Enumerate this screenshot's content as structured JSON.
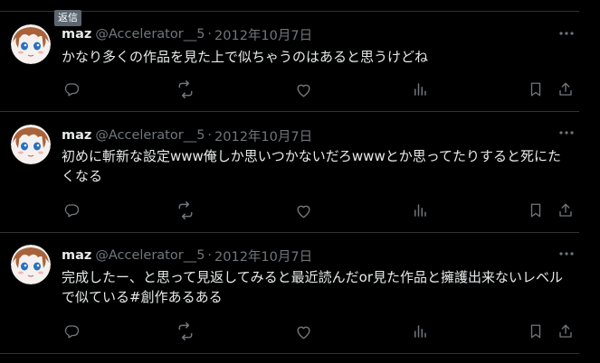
{
  "tooltip": {
    "reply": "返信"
  },
  "tweets": [
    {
      "name": "maz",
      "handle": "@Accelerator__5",
      "separator": "·",
      "date": "2012年10月7日",
      "text": "かなり多くの作品を見た上で似ちゃうのはあると思うけどね"
    },
    {
      "name": "maz",
      "handle": "@Accelerator__5",
      "separator": "·",
      "date": "2012年10月7日",
      "text": "初めに斬新な設定www俺しか思いつかないだろwwwとか思ってたりすると死にたくなる"
    },
    {
      "name": "maz",
      "handle": "@Accelerator__5",
      "separator": "·",
      "date": "2012年10月7日",
      "text": "完成したー、と思って見返してみると最近読んだor見た作品と擁護出来ないレベルで似ている#創作あるある"
    }
  ],
  "icons": {
    "reply": "reply-icon",
    "retweet": "retweet-icon",
    "like": "like-icon",
    "views": "views-icon",
    "bookmark": "bookmark-icon",
    "share": "share-icon",
    "more": "more-icon"
  },
  "colors": {
    "background": "#000000",
    "text": "#e7e9ea",
    "secondary": "#71767b",
    "divider": "#2f3336",
    "tooltip_bg": "#5b6670"
  }
}
